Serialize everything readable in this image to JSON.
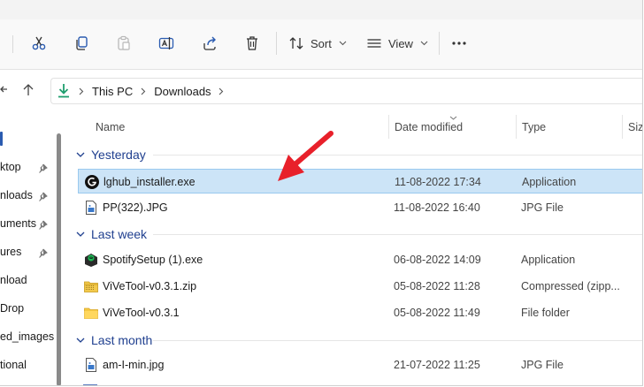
{
  "toolbar": {
    "sort_label": "Sort",
    "view_label": "View"
  },
  "address": {
    "crumbs": [
      "This PC",
      "Downloads"
    ]
  },
  "sidebar": {
    "items": [
      {
        "label": "ktop",
        "pinned": true
      },
      {
        "label": "nloads",
        "pinned": true
      },
      {
        "label": "uments",
        "pinned": true
      },
      {
        "label": "ures",
        "pinned": true
      },
      {
        "label": "nload",
        "pinned": false
      },
      {
        "label": "Drop",
        "pinned": false
      },
      {
        "label": "ed_images",
        "pinned": false
      },
      {
        "label": "tional",
        "pinned": false
      }
    ]
  },
  "columns": {
    "name": "Name",
    "date": "Date modified",
    "type": "Type",
    "size": "Size"
  },
  "groups": [
    {
      "label": "Yesterday",
      "files": [
        {
          "name": "lghub_installer.exe",
          "date": "11-08-2022 17:34",
          "type": "Application",
          "icon": "logitech-app-icon",
          "selected": true
        },
        {
          "name": "PP(322).JPG",
          "date": "11-08-2022 16:40",
          "type": "JPG File",
          "icon": "image-file-icon",
          "selected": false
        }
      ]
    },
    {
      "label": "Last week",
      "files": [
        {
          "name": "SpotifySetup (1).exe",
          "date": "06-08-2022 14:09",
          "type": "Application",
          "icon": "spotify-setup-icon",
          "selected": false
        },
        {
          "name": "ViVeTool-v0.3.1.zip",
          "date": "05-08-2022 11:28",
          "type": "Compressed (zipp...",
          "icon": "zip-folder-icon",
          "selected": false
        },
        {
          "name": "ViVeTool-v0.3.1",
          "date": "05-08-2022 11:49",
          "type": "File folder",
          "icon": "folder-icon",
          "selected": false
        }
      ]
    },
    {
      "label": "Last month",
      "files": [
        {
          "name": "am-I-min.jpg",
          "date": "21-07-2022 11:25",
          "type": "JPG File",
          "icon": "image-file-icon",
          "selected": false
        }
      ]
    }
  ],
  "colors": {
    "accent": "#1f3f8f",
    "selection": "#cce4f7",
    "annotation_arrow": "#e8202a"
  }
}
